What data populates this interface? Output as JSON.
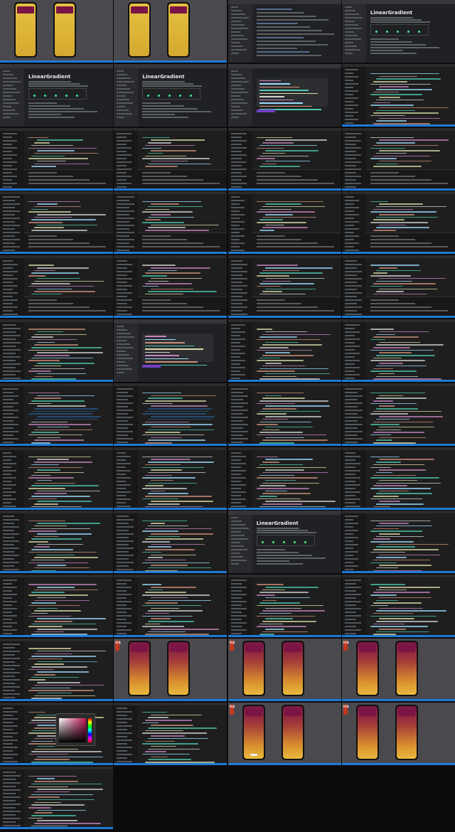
{
  "sheet": {
    "columns": 4,
    "rows": 13,
    "frame_count": 49
  },
  "labels": {
    "doc_heading": "LinearGradient",
    "logo_text": "ICA"
  },
  "colors": {
    "editor_bg": "#1e1e1e",
    "sidebar_bg": "#181818",
    "status_bar": "#1f7ad6",
    "keyword": "#c586c0",
    "string": "#ce9178",
    "identifier": "#9cdcfe",
    "type": "#4ec9b0",
    "function": "#dcdcaa",
    "gradient_top": "#7a1545",
    "gradient_bottom_initial": "#d9b23a",
    "browser_bg": "#202124"
  },
  "frames": [
    {
      "kind": "simulator",
      "gradient": "yellow"
    },
    {
      "kind": "simulator",
      "gradient": "yellow"
    },
    {
      "kind": "browser-search"
    },
    {
      "kind": "browser-docs"
    },
    {
      "kind": "browser-docs"
    },
    {
      "kind": "browser-docs"
    },
    {
      "kind": "browser-usage"
    },
    {
      "kind": "editor",
      "panel": false
    },
    {
      "kind": "editor",
      "panel": true
    },
    {
      "kind": "editor",
      "panel": true
    },
    {
      "kind": "editor",
      "panel": true
    },
    {
      "kind": "editor",
      "panel": true
    },
    {
      "kind": "editor",
      "panel": true
    },
    {
      "kind": "editor",
      "panel": true
    },
    {
      "kind": "editor",
      "panel": true
    },
    {
      "kind": "editor",
      "panel": true
    },
    {
      "kind": "editor",
      "panel": true
    },
    {
      "kind": "editor",
      "panel": true
    },
    {
      "kind": "editor",
      "panel": true
    },
    {
      "kind": "editor",
      "panel": true
    },
    {
      "kind": "editor",
      "panel": false
    },
    {
      "kind": "browser-usage"
    },
    {
      "kind": "editor",
      "panel": false
    },
    {
      "kind": "editor",
      "panel": false
    },
    {
      "kind": "editor",
      "panel": false,
      "selection": true
    },
    {
      "kind": "editor",
      "panel": false,
      "selection": true
    },
    {
      "kind": "editor",
      "panel": false
    },
    {
      "kind": "editor",
      "panel": false
    },
    {
      "kind": "editor",
      "panel": false
    },
    {
      "kind": "editor",
      "panel": false
    },
    {
      "kind": "editor",
      "panel": false
    },
    {
      "kind": "editor",
      "panel": false
    },
    {
      "kind": "editor",
      "panel": false
    },
    {
      "kind": "editor",
      "panel": false
    },
    {
      "kind": "browser-docs-dark"
    },
    {
      "kind": "editor",
      "panel": false
    },
    {
      "kind": "editor",
      "panel": false
    },
    {
      "kind": "editor",
      "panel": false
    },
    {
      "kind": "editor",
      "panel": false
    },
    {
      "kind": "editor",
      "panel": false
    },
    {
      "kind": "editor",
      "panel": false
    },
    {
      "kind": "simulator",
      "gradient": "maroon-to-gold"
    },
    {
      "kind": "simulator",
      "gradient": "maroon-to-gold"
    },
    {
      "kind": "simulator",
      "gradient": "maroon-to-gold"
    },
    {
      "kind": "editor",
      "panel": false,
      "picker": true
    },
    {
      "kind": "editor",
      "panel": false
    },
    {
      "kind": "simulator",
      "gradient": "maroon-to-gold",
      "toast": true
    },
    {
      "kind": "simulator",
      "gradient": "maroon-to-gold"
    },
    {
      "kind": "editor",
      "panel": false
    }
  ]
}
